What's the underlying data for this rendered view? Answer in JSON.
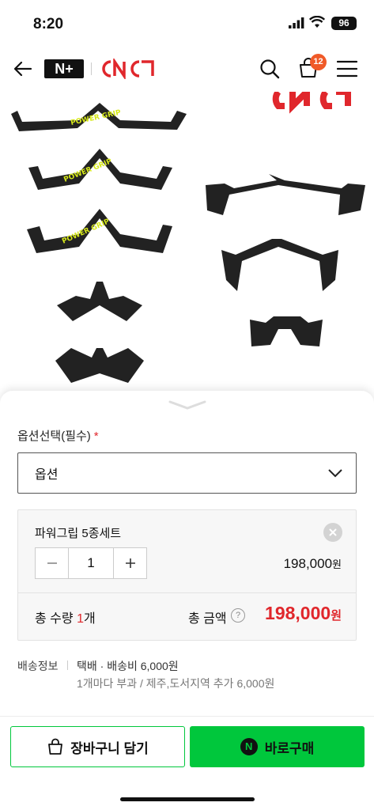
{
  "status_bar": {
    "time": "8:20",
    "battery": "96"
  },
  "header": {
    "nplus_logo": "N+",
    "brand_logo": "CNC",
    "cart_count": "12"
  },
  "product_image": {
    "brand_text": "CNC",
    "grip_text": "POWER GRIP"
  },
  "option_section": {
    "label": "옵션선택(필수)",
    "required_mark": "*",
    "select_value": "옵션"
  },
  "selected_item": {
    "name": "파워그립 5종세트",
    "quantity": "1",
    "price": "198,000",
    "price_unit": "원"
  },
  "totals": {
    "qty_label": "총 수량",
    "qty_value": "1",
    "qty_unit": "개",
    "amount_label": "총 금액",
    "help_mark": "?",
    "amount": "198,000",
    "amount_unit": "원"
  },
  "shipping": {
    "label": "배송정보",
    "line1": "택배 · 배송비 6,000원",
    "line2": "1개마다 부과 / 제주,도서지역 추가 6,000원"
  },
  "buttons": {
    "cart": "장바구니 담기",
    "buy": "바로구매",
    "buy_badge": "N"
  },
  "colors": {
    "accent_green": "#00c73c",
    "price_red": "#e0272c",
    "badge_orange": "#f05a28"
  }
}
